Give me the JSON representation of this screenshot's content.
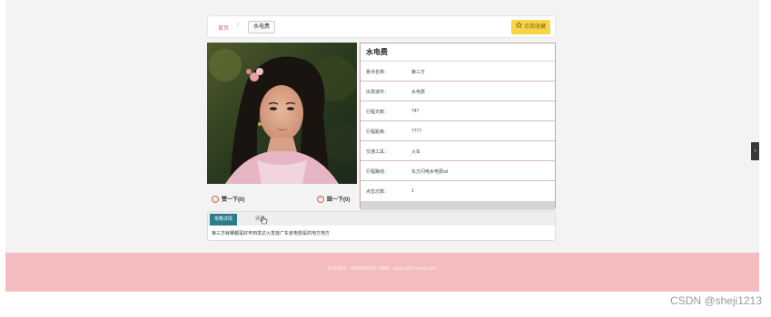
{
  "breadcrumb": {
    "home": "首页",
    "separator": "/",
    "current": "水电费"
  },
  "actions": {
    "favorite_label": "点我收藏",
    "favorite_icon": "star-icon"
  },
  "detail": {
    "title": "水电费",
    "rows": [
      {
        "label": "景点名称：",
        "value": "第三方"
      },
      {
        "label": "出发城市：",
        "value": "水电费"
      },
      {
        "label": "行程天数：",
        "value": "747"
      },
      {
        "label": "行程距离：",
        "value": "7777"
      },
      {
        "label": "交通工具：",
        "value": "火车"
      },
      {
        "label": "行程路线：",
        "value": "东方闪电水电费sd"
      },
      {
        "label": "点击次数：",
        "value": "1"
      }
    ]
  },
  "votes": {
    "up_label": "赞一下(0)",
    "down_label": "踩一下(0)"
  },
  "tabs": {
    "details_label": "攻略详情",
    "comment_label": "评论"
  },
  "content": {
    "text": "第三方就哪都是好丰田发达火发放广东省电想是的地方地方"
  },
  "footer": {
    "text": "联系电话：8888888888 | 邮箱：support@7mgeh.com"
  },
  "watermark": "CSDN @sheji1213",
  "colors": {
    "accent_teal": "#2a7d8c",
    "footer_pink": "#f4bcbf",
    "favorite_yellow": "#f6d648",
    "panel_border": "#c9a3a3"
  }
}
